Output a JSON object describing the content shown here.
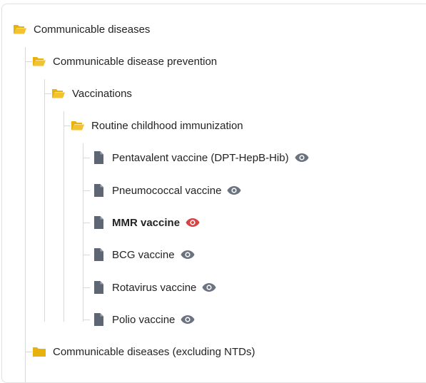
{
  "tree": {
    "root": {
      "label": "Communicable diseases",
      "icon": "folder-open-icon"
    },
    "prevention": {
      "label": "Communicable disease prevention",
      "icon": "folder-open-icon"
    },
    "vaccinations": {
      "label": "Vaccinations",
      "icon": "folder-open-icon"
    },
    "routine": {
      "label": "Routine childhood immunization",
      "icon": "folder-open-icon"
    },
    "items": [
      {
        "label": "Pentavalent vaccine (DPT-HepB-Hib)",
        "icon": "document-icon",
        "eye_color": "#6b7280",
        "selected": false
      },
      {
        "label": "Pneumococcal vaccine",
        "icon": "document-icon",
        "eye_color": "#6b7280",
        "selected": false
      },
      {
        "label": "MMR vaccine",
        "icon": "document-icon",
        "eye_color": "#d64545",
        "selected": true
      },
      {
        "label": "BCG vaccine",
        "icon": "document-icon",
        "eye_color": "#6b7280",
        "selected": false
      },
      {
        "label": "Rotavirus vaccine",
        "icon": "document-icon",
        "eye_color": "#6b7280",
        "selected": false
      },
      {
        "label": "Polio vaccine",
        "icon": "document-icon",
        "eye_color": "#6b7280",
        "selected": false
      }
    ],
    "excluding": {
      "label": "Communicable diseases (excluding NTDs)",
      "icon": "folder-closed-icon"
    }
  },
  "colors": {
    "folder": "#e8b20e",
    "document": "#5f6673",
    "eye_default": "#6b7280",
    "eye_active": "#d64545",
    "guide_line": "#d8d8d8"
  }
}
